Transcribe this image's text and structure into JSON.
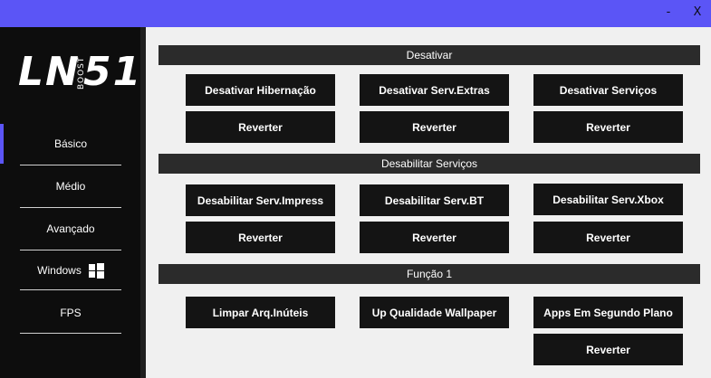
{
  "window": {
    "minimize_label": "-",
    "close_label": "X",
    "accent": "#5b55f6"
  },
  "logo": {
    "main_left": "LN",
    "main_right": "51",
    "sub": "BOOST"
  },
  "sidebar": {
    "items": [
      {
        "label": "Básico"
      },
      {
        "label": "Médio"
      },
      {
        "label": "Avançado"
      },
      {
        "label": "Windows",
        "icon": "windows-icon"
      },
      {
        "label": "FPS"
      }
    ]
  },
  "sections": [
    {
      "title": "Desativar",
      "buttons": [
        {
          "label": "Desativar Hibernação"
        },
        {
          "label": "Desativar Serv.Extras"
        },
        {
          "label": "Desativar Serviços"
        },
        {
          "label": "Reverter"
        },
        {
          "label": "Reverter"
        },
        {
          "label": "Reverter"
        }
      ]
    },
    {
      "title": "Desabilitar Serviços",
      "buttons": [
        {
          "label": "Desabilitar Serv.Impress"
        },
        {
          "label": "Desabilitar Serv.BT"
        },
        {
          "label": "Desabilitar Serv.Xbox"
        },
        {
          "label": "Reverter"
        },
        {
          "label": "Reverter"
        },
        {
          "label": "Reverter"
        }
      ]
    },
    {
      "title": "Função 1",
      "buttons": [
        {
          "label": "Limpar Arq.Inúteis"
        },
        {
          "label": "Up Qualidade Wallpaper"
        },
        {
          "label": "Apps Em Segundo Plano"
        },
        {
          "label": "Reverter"
        }
      ]
    }
  ]
}
